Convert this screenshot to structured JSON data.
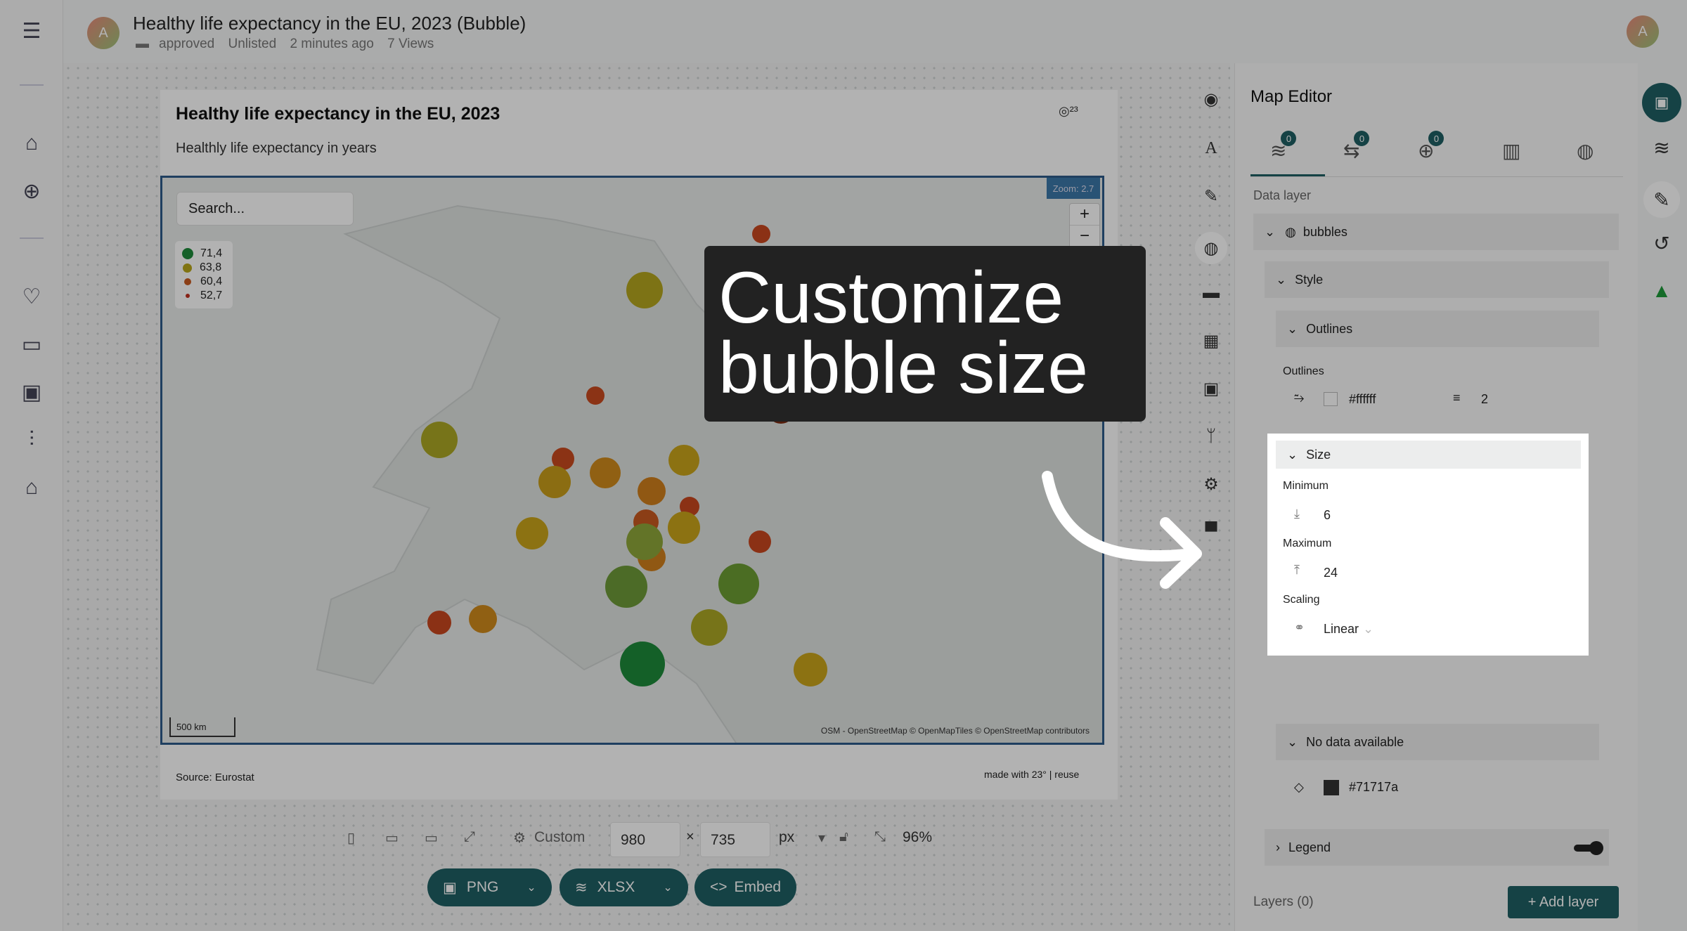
{
  "header": {
    "avatar_letter": "A",
    "title": "Healthy life expectancy in the EU, 2023 (Bubble)",
    "meta": [
      "approved",
      "Unlisted",
      "2 minutes ago",
      "7 Views"
    ]
  },
  "chart": {
    "title": "Healthy life expectancy in the EU, 2023",
    "subtitle": "Healthly life expectancy in years",
    "search_placeholder": "Search...",
    "zoom_label": "Zoom: 2.7",
    "scale_label": "500 km",
    "attribution": "OSM - OpenStreetMap   © OpenMapTiles © OpenStreetMap contributors",
    "source": "Source: Eurostat",
    "made_with": "made with 23° | reuse",
    "legend": [
      {
        "label": "71,4",
        "color": "#1e8a3a"
      },
      {
        "label": "63,8",
        "color": "#b8a61a"
      },
      {
        "label": "60,4",
        "color": "#c85a20"
      },
      {
        "label": "52,7",
        "color": "#c03020"
      }
    ]
  },
  "chart_data": {
    "type": "scatter",
    "title": "Healthy life expectancy in the EU, 2023",
    "subtitle": "Healthly life expectancy in years",
    "legend": [
      "71,4",
      "63,8",
      "60,4",
      "52,7"
    ],
    "size": {
      "minimum": 6,
      "maximum": 24,
      "scaling": "Linear"
    }
  },
  "toolbar": {
    "preset": "Custom",
    "width": "980",
    "height": "735",
    "unit": "px",
    "zoom": "96%",
    "png_label": "PNG",
    "xlsx_label": "XLSX",
    "embed_label": "Embed"
  },
  "editor": {
    "title": "Map Editor",
    "tab_badges": [
      "0",
      "0",
      "0"
    ],
    "data_layer_label": "Data layer",
    "layer_name": "bubbles",
    "style_label": "Style",
    "outlines_section": "Outlines",
    "outlines_label": "Outlines",
    "outline_color": "#ffffff",
    "outline_width": "2",
    "size_label": "Size",
    "minimum_label": "Minimum",
    "minimum_value": "6",
    "maximum_label": "Maximum",
    "maximum_value": "24",
    "scaling_label": "Scaling",
    "scaling_value": "Linear",
    "nodata_label": "No data available",
    "nodata_color": "#71717a",
    "legend_label": "Legend",
    "layers_count": "Layers (0)",
    "add_layer": "+ Add layer"
  },
  "overlay": {
    "callout_text": "Customize bubble size"
  }
}
